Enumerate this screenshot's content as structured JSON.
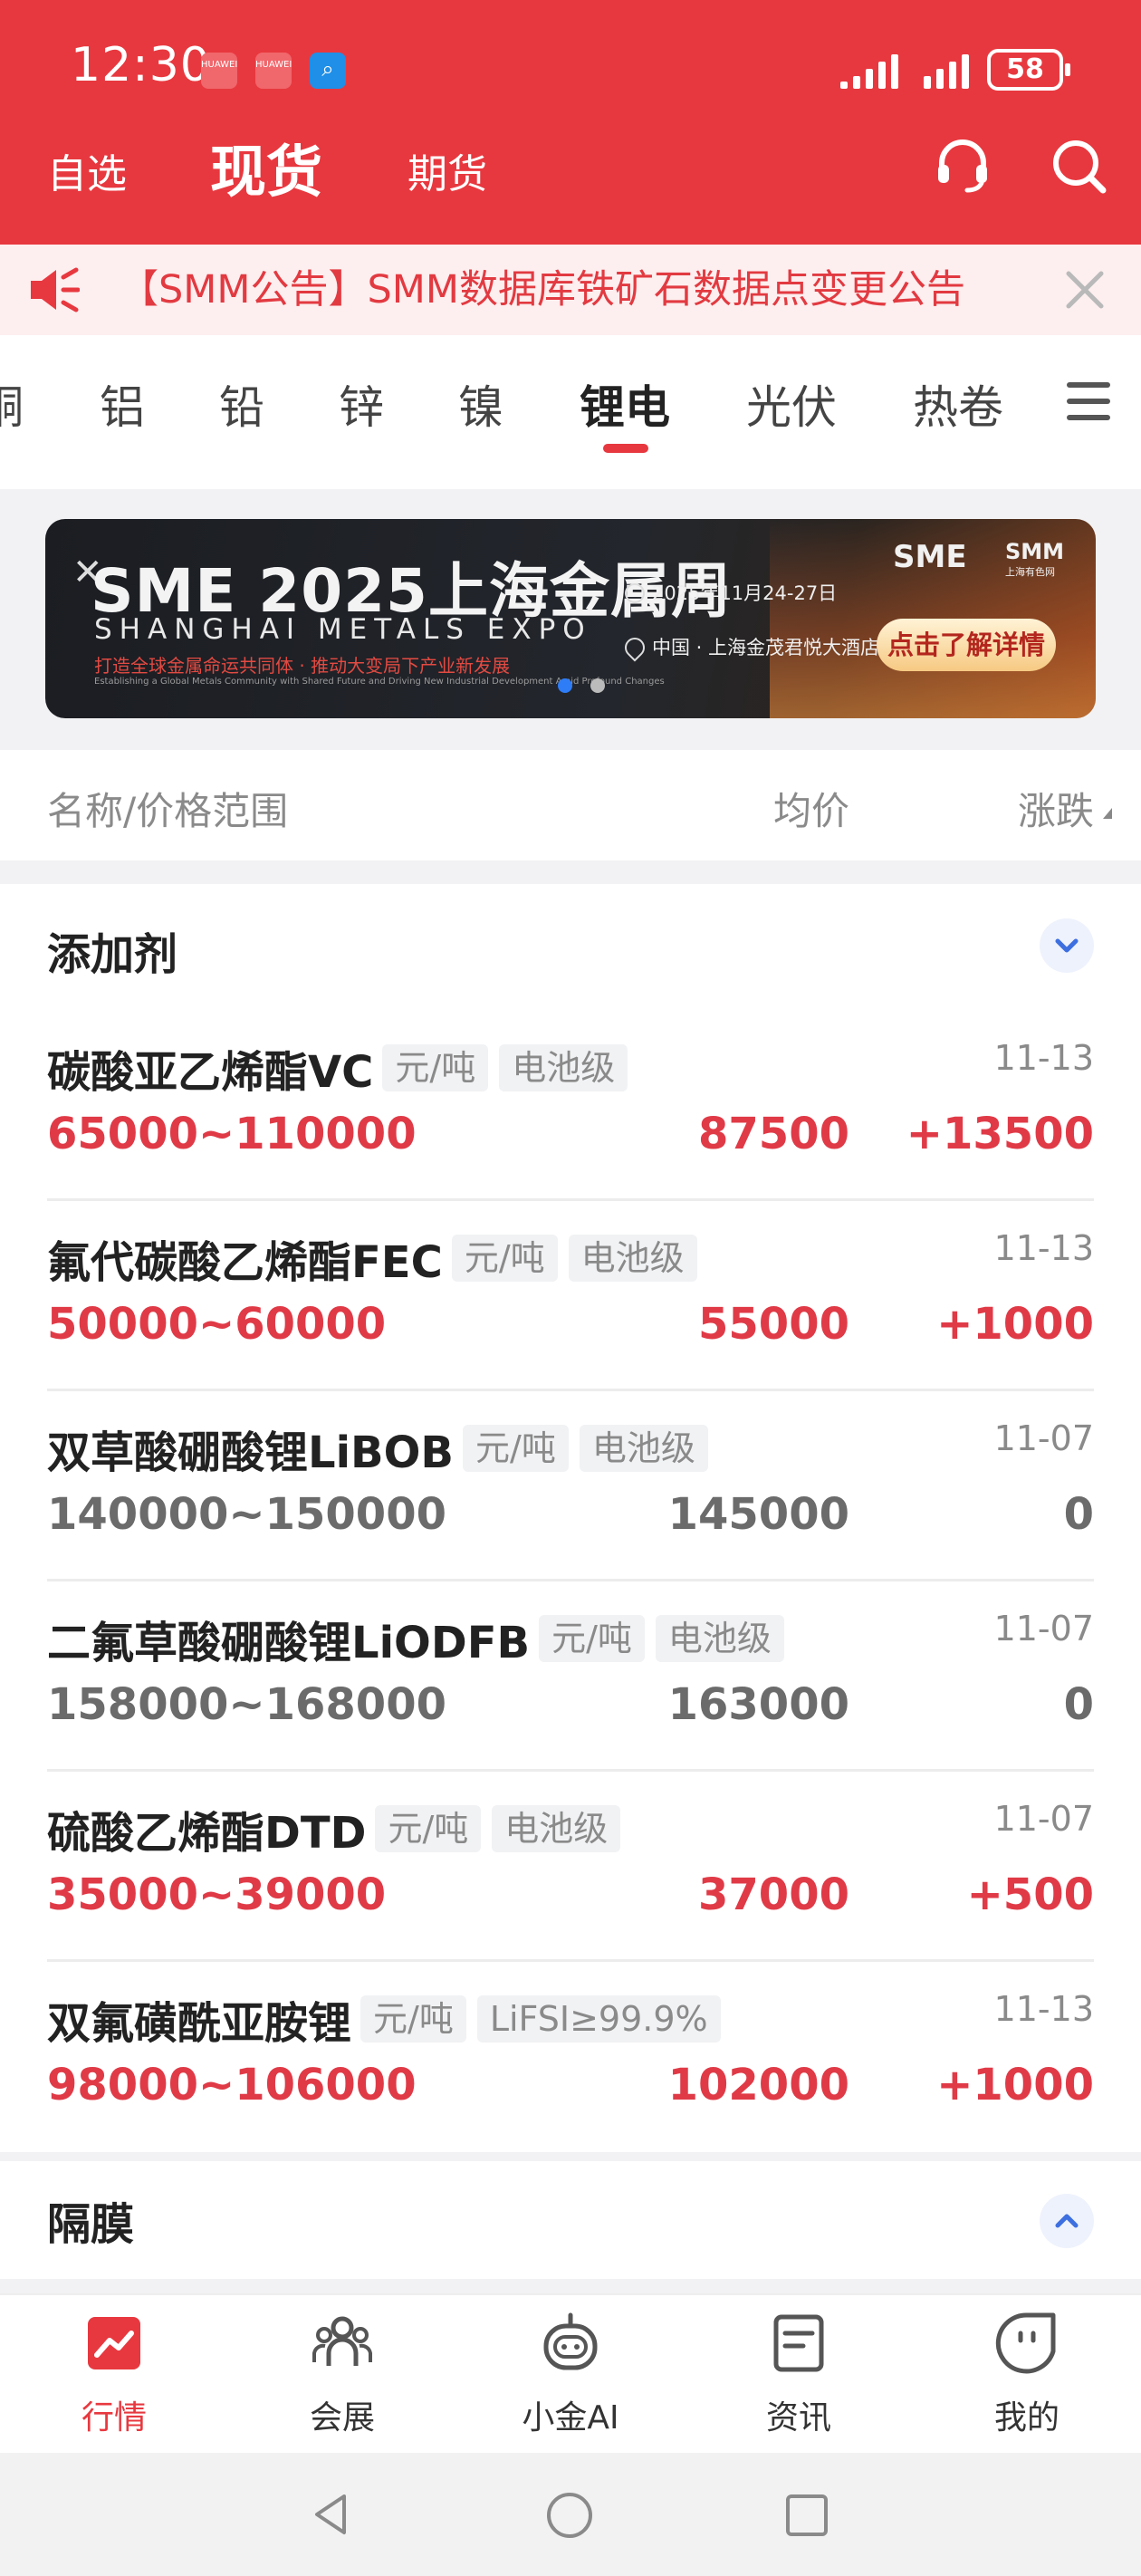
{
  "status_bar": {
    "time": "12:30",
    "battery": "58",
    "app_icons": [
      "huawei-icon",
      "huawei-icon",
      "search-app-icon"
    ]
  },
  "top_nav": {
    "tabs": [
      "自选",
      "现货",
      "期货"
    ],
    "active": "现货"
  },
  "notice": {
    "text": "【SMM公告】SMM数据库铁矿石数据点变更公告"
  },
  "categories": {
    "items": [
      "铜",
      "铝",
      "铅",
      "锌",
      "镍",
      "锂电",
      "光伏",
      "热卷"
    ],
    "active": "锂电"
  },
  "banner": {
    "title": "SME 2025上海金属周",
    "subtitle": "SHANGHAI METALS EXPO",
    "slogan": "打造全球金属命运共同体 · 推动大变局下产业新发展",
    "tiny": "Establishing a Global Metals Community with Shared Future and Driving New Industrial Development Amid Profound Changes",
    "date": "2025年11月24-27日",
    "location": "中国 · 上海金茂君悦大酒店",
    "logo1": "SME",
    "logo2": "SMM",
    "logo2_sub": "上海有色网",
    "cta": "点击了解详情"
  },
  "table_header": {
    "name": "名称/价格范围",
    "avg": "均价",
    "change": "涨跌"
  },
  "sections": [
    {
      "title": "添加剂",
      "rows": [
        {
          "name": "碳酸亚乙烯酯VC",
          "unit": "元/吨",
          "grade": "电池级",
          "date": "11-13",
          "range": "65000~110000",
          "avg": "87500",
          "change": "+13500",
          "trend": "up"
        },
        {
          "name": "氟代碳酸乙烯酯FEC",
          "unit": "元/吨",
          "grade": "电池级",
          "date": "11-13",
          "range": "50000~60000",
          "avg": "55000",
          "change": "+1000",
          "trend": "up"
        },
        {
          "name": "双草酸硼酸锂LiBOB",
          "unit": "元/吨",
          "grade": "电池级",
          "date": "11-07",
          "range": "140000~150000",
          "avg": "145000",
          "change": "0",
          "trend": "flat"
        },
        {
          "name": "二氟草酸硼酸锂LiODFB",
          "unit": "元/吨",
          "grade": "电池级",
          "date": "11-07",
          "range": "158000~168000",
          "avg": "163000",
          "change": "0",
          "trend": "flat"
        },
        {
          "name": "硫酸乙烯酯DTD",
          "unit": "元/吨",
          "grade": "电池级",
          "date": "11-07",
          "range": "35000~39000",
          "avg": "37000",
          "change": "+500",
          "trend": "up"
        },
        {
          "name": "双氟磺酰亚胺锂",
          "unit": "元/吨",
          "grade": "LiFSI≥99.9%",
          "date": "11-13",
          "range": "98000~106000",
          "avg": "102000",
          "change": "+1000",
          "trend": "up"
        }
      ]
    },
    {
      "title": "隔膜"
    }
  ],
  "bottom_nav": {
    "items": [
      "行情",
      "会展",
      "小金AI",
      "资讯",
      "我的"
    ],
    "active": "行情"
  },
  "colors": {
    "brand_red": "#e8383f",
    "up_red": "#e03a47",
    "flat_gray": "#6b6b6b",
    "chevron_blue": "#3d6fe0"
  }
}
